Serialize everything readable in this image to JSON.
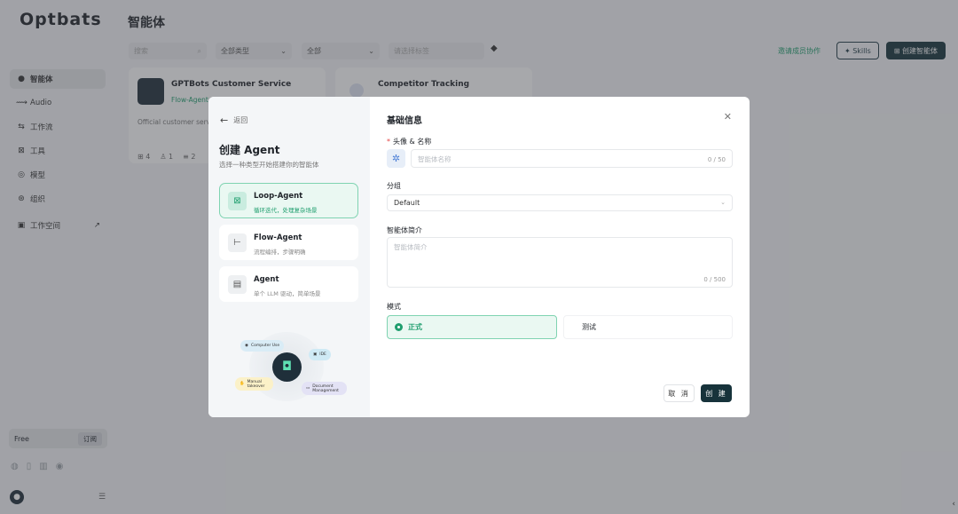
{
  "app": {
    "logo": "Optbats",
    "page_title": "智能体",
    "nav": [
      {
        "icon": "chat-bubble-icon",
        "glyph": "●",
        "label": "智能体",
        "active": true
      },
      {
        "icon": "audio-wave-icon",
        "glyph": "⟿",
        "label": "Audio"
      },
      {
        "icon": "workflow-icon",
        "glyph": "⇆",
        "label": "工作流"
      },
      {
        "icon": "tool-icon",
        "glyph": "⊠",
        "label": "工具"
      },
      {
        "icon": "model-icon",
        "glyph": "◎",
        "label": "模型"
      },
      {
        "icon": "org-icon",
        "glyph": "⊛",
        "label": "组织"
      }
    ],
    "workspace": {
      "label": "工作空间",
      "glyph": "▣",
      "arrow": "↗"
    },
    "plan": {
      "label": "Free",
      "badge": "订阅"
    },
    "filters": {
      "search_placeholder": "搜索",
      "type": "全部类型",
      "all": "全部",
      "tag_placeholder": "请选择标签"
    },
    "actions": {
      "invite": "邀请成员协作",
      "skills": "✦ Skills",
      "create": "⊞ 创建智能体"
    },
    "cards": [
      {
        "title": "GPTBots Customer Service",
        "sub": "Flow-Agent",
        "desc": "Official customer service",
        "stats": [
          "⊞ 4",
          "♙ 1",
          "≡ 2"
        ]
      },
      {
        "title": "Competitor Tracking"
      }
    ]
  },
  "modal": {
    "back": "返回",
    "title": "创建 Agent",
    "subtitle": "选择一种类型开始搭建你的智能体",
    "types": [
      {
        "name": "Loop-Agent",
        "desc": "循环迭代，处理复杂场景",
        "glyph": "⊠",
        "selected": true
      },
      {
        "name": "Flow-Agent",
        "desc": "流程编排，步骤明确",
        "glyph": "⊢"
      },
      {
        "name": "Agent",
        "desc": "单个 LLM 驱动，简单场景",
        "glyph": "▤"
      }
    ],
    "illustration": {
      "chips": [
        "Computer Use",
        "IDE",
        "Manual takeover",
        "Document Management"
      ]
    },
    "form": {
      "section_title": "基础信息",
      "avatar_name_label": "头像 & 名称",
      "name_placeholder": "智能体名称",
      "name_counter": "0 / 50",
      "group_label": "分组",
      "group_value": "Default",
      "desc_label": "智能体简介",
      "desc_placeholder": "智能体简介",
      "desc_counter": "0 / 500",
      "mode_label": "模式",
      "mode_formal": "正式",
      "mode_test": "测试",
      "cancel": "取 消",
      "create": "创 建"
    }
  }
}
